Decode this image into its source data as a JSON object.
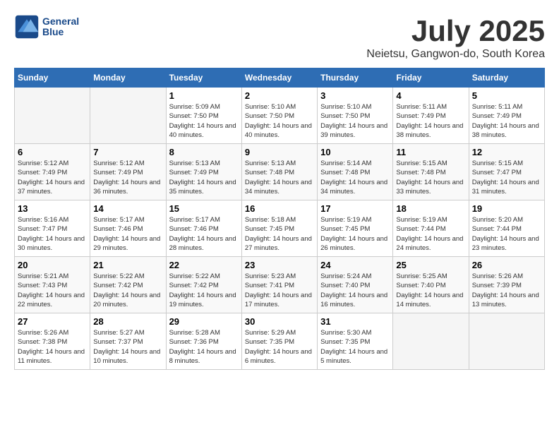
{
  "header": {
    "logo_line1": "General",
    "logo_line2": "Blue",
    "month_title": "July 2025",
    "location": "Neietsu, Gangwon-do, South Korea"
  },
  "weekdays": [
    "Sunday",
    "Monday",
    "Tuesday",
    "Wednesday",
    "Thursday",
    "Friday",
    "Saturday"
  ],
  "weeks": [
    [
      {
        "day": "",
        "sunrise": "",
        "sunset": "",
        "daylight": "",
        "empty": true
      },
      {
        "day": "",
        "sunrise": "",
        "sunset": "",
        "daylight": "",
        "empty": true
      },
      {
        "day": "1",
        "sunrise": "Sunrise: 5:09 AM",
        "sunset": "Sunset: 7:50 PM",
        "daylight": "Daylight: 14 hours and 40 minutes."
      },
      {
        "day": "2",
        "sunrise": "Sunrise: 5:10 AM",
        "sunset": "Sunset: 7:50 PM",
        "daylight": "Daylight: 14 hours and 40 minutes."
      },
      {
        "day": "3",
        "sunrise": "Sunrise: 5:10 AM",
        "sunset": "Sunset: 7:50 PM",
        "daylight": "Daylight: 14 hours and 39 minutes."
      },
      {
        "day": "4",
        "sunrise": "Sunrise: 5:11 AM",
        "sunset": "Sunset: 7:49 PM",
        "daylight": "Daylight: 14 hours and 38 minutes."
      },
      {
        "day": "5",
        "sunrise": "Sunrise: 5:11 AM",
        "sunset": "Sunset: 7:49 PM",
        "daylight": "Daylight: 14 hours and 38 minutes."
      }
    ],
    [
      {
        "day": "6",
        "sunrise": "Sunrise: 5:12 AM",
        "sunset": "Sunset: 7:49 PM",
        "daylight": "Daylight: 14 hours and 37 minutes."
      },
      {
        "day": "7",
        "sunrise": "Sunrise: 5:12 AM",
        "sunset": "Sunset: 7:49 PM",
        "daylight": "Daylight: 14 hours and 36 minutes."
      },
      {
        "day": "8",
        "sunrise": "Sunrise: 5:13 AM",
        "sunset": "Sunset: 7:49 PM",
        "daylight": "Daylight: 14 hours and 35 minutes."
      },
      {
        "day": "9",
        "sunrise": "Sunrise: 5:13 AM",
        "sunset": "Sunset: 7:48 PM",
        "daylight": "Daylight: 14 hours and 34 minutes."
      },
      {
        "day": "10",
        "sunrise": "Sunrise: 5:14 AM",
        "sunset": "Sunset: 7:48 PM",
        "daylight": "Daylight: 14 hours and 34 minutes."
      },
      {
        "day": "11",
        "sunrise": "Sunrise: 5:15 AM",
        "sunset": "Sunset: 7:48 PM",
        "daylight": "Daylight: 14 hours and 33 minutes."
      },
      {
        "day": "12",
        "sunrise": "Sunrise: 5:15 AM",
        "sunset": "Sunset: 7:47 PM",
        "daylight": "Daylight: 14 hours and 31 minutes."
      }
    ],
    [
      {
        "day": "13",
        "sunrise": "Sunrise: 5:16 AM",
        "sunset": "Sunset: 7:47 PM",
        "daylight": "Daylight: 14 hours and 30 minutes."
      },
      {
        "day": "14",
        "sunrise": "Sunrise: 5:17 AM",
        "sunset": "Sunset: 7:46 PM",
        "daylight": "Daylight: 14 hours and 29 minutes."
      },
      {
        "day": "15",
        "sunrise": "Sunrise: 5:17 AM",
        "sunset": "Sunset: 7:46 PM",
        "daylight": "Daylight: 14 hours and 28 minutes."
      },
      {
        "day": "16",
        "sunrise": "Sunrise: 5:18 AM",
        "sunset": "Sunset: 7:45 PM",
        "daylight": "Daylight: 14 hours and 27 minutes."
      },
      {
        "day": "17",
        "sunrise": "Sunrise: 5:19 AM",
        "sunset": "Sunset: 7:45 PM",
        "daylight": "Daylight: 14 hours and 26 minutes."
      },
      {
        "day": "18",
        "sunrise": "Sunrise: 5:19 AM",
        "sunset": "Sunset: 7:44 PM",
        "daylight": "Daylight: 14 hours and 24 minutes."
      },
      {
        "day": "19",
        "sunrise": "Sunrise: 5:20 AM",
        "sunset": "Sunset: 7:44 PM",
        "daylight": "Daylight: 14 hours and 23 minutes."
      }
    ],
    [
      {
        "day": "20",
        "sunrise": "Sunrise: 5:21 AM",
        "sunset": "Sunset: 7:43 PM",
        "daylight": "Daylight: 14 hours and 22 minutes."
      },
      {
        "day": "21",
        "sunrise": "Sunrise: 5:22 AM",
        "sunset": "Sunset: 7:42 PM",
        "daylight": "Daylight: 14 hours and 20 minutes."
      },
      {
        "day": "22",
        "sunrise": "Sunrise: 5:22 AM",
        "sunset": "Sunset: 7:42 PM",
        "daylight": "Daylight: 14 hours and 19 minutes."
      },
      {
        "day": "23",
        "sunrise": "Sunrise: 5:23 AM",
        "sunset": "Sunset: 7:41 PM",
        "daylight": "Daylight: 14 hours and 17 minutes."
      },
      {
        "day": "24",
        "sunrise": "Sunrise: 5:24 AM",
        "sunset": "Sunset: 7:40 PM",
        "daylight": "Daylight: 14 hours and 16 minutes."
      },
      {
        "day": "25",
        "sunrise": "Sunrise: 5:25 AM",
        "sunset": "Sunset: 7:40 PM",
        "daylight": "Daylight: 14 hours and 14 minutes."
      },
      {
        "day": "26",
        "sunrise": "Sunrise: 5:26 AM",
        "sunset": "Sunset: 7:39 PM",
        "daylight": "Daylight: 14 hours and 13 minutes."
      }
    ],
    [
      {
        "day": "27",
        "sunrise": "Sunrise: 5:26 AM",
        "sunset": "Sunset: 7:38 PM",
        "daylight": "Daylight: 14 hours and 11 minutes."
      },
      {
        "day": "28",
        "sunrise": "Sunrise: 5:27 AM",
        "sunset": "Sunset: 7:37 PM",
        "daylight": "Daylight: 14 hours and 10 minutes."
      },
      {
        "day": "29",
        "sunrise": "Sunrise: 5:28 AM",
        "sunset": "Sunset: 7:36 PM",
        "daylight": "Daylight: 14 hours and 8 minutes."
      },
      {
        "day": "30",
        "sunrise": "Sunrise: 5:29 AM",
        "sunset": "Sunset: 7:35 PM",
        "daylight": "Daylight: 14 hours and 6 minutes."
      },
      {
        "day": "31",
        "sunrise": "Sunrise: 5:30 AM",
        "sunset": "Sunset: 7:35 PM",
        "daylight": "Daylight: 14 hours and 5 minutes."
      },
      {
        "day": "",
        "sunrise": "",
        "sunset": "",
        "daylight": "",
        "empty": true
      },
      {
        "day": "",
        "sunrise": "",
        "sunset": "",
        "daylight": "",
        "empty": true
      }
    ]
  ]
}
